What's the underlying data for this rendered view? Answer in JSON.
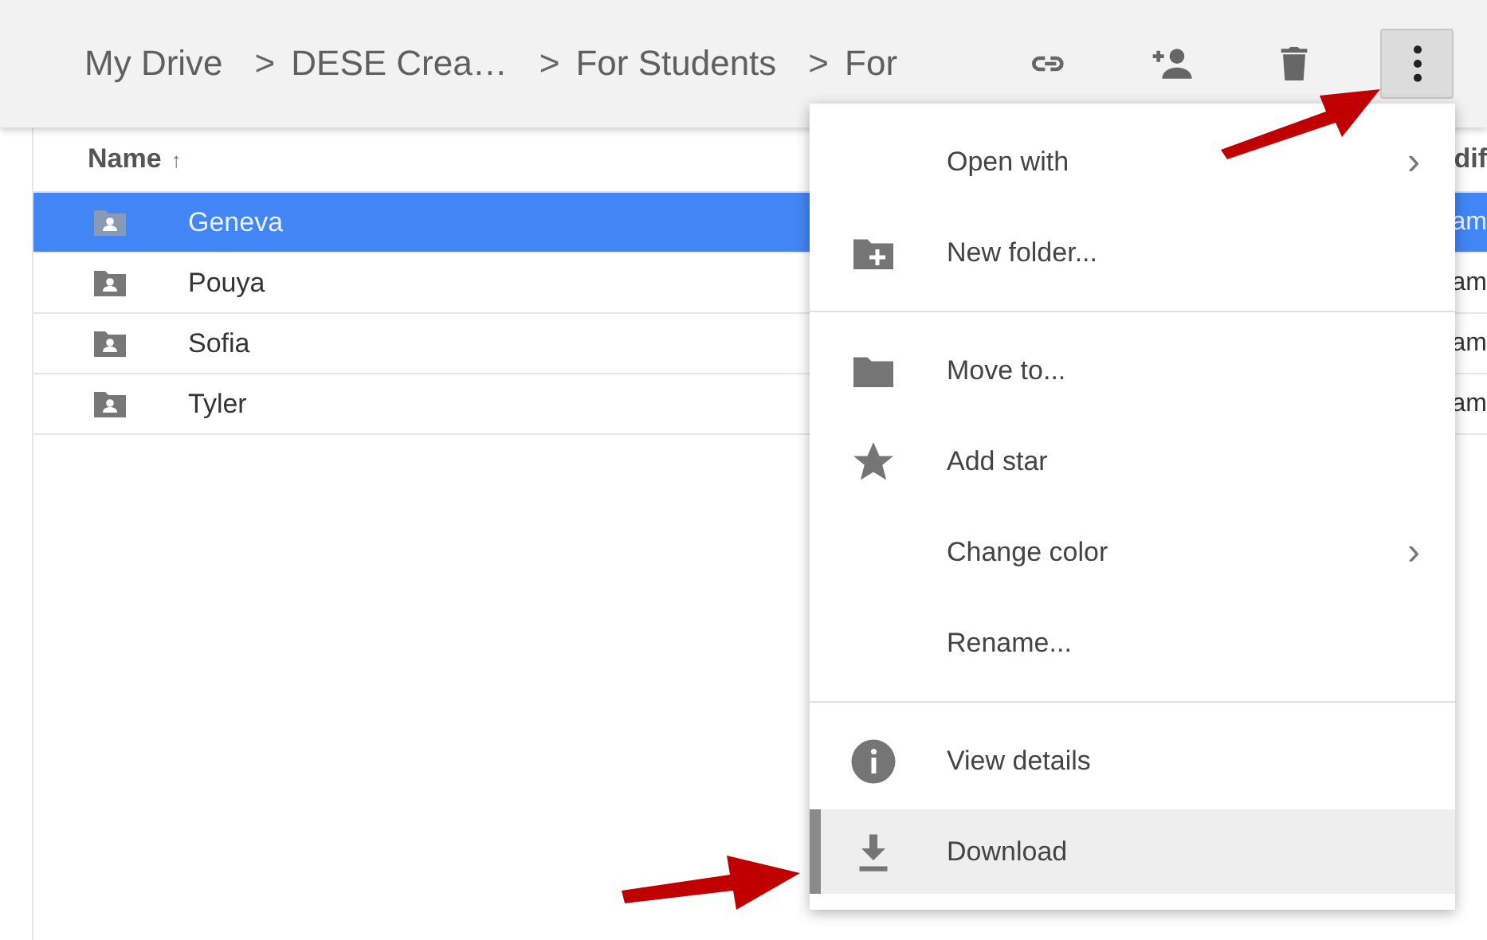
{
  "toolbar": {
    "breadcrumbs": [
      {
        "label": "My Drive"
      },
      {
        "separator": ">",
        "label": "DESE Crea…"
      },
      {
        "separator": ">",
        "label": "For Students"
      },
      {
        "separator": ">",
        "label": "For"
      }
    ],
    "actions": [
      {
        "kind": "link",
        "selected": false
      },
      {
        "kind": "share",
        "selected": false
      },
      {
        "kind": "trash",
        "selected": false
      },
      {
        "kind": "more",
        "selected": true
      }
    ]
  },
  "table": {
    "columns": [
      {
        "label": "Name",
        "sort": "↑"
      },
      {
        "label": "dif"
      }
    ],
    "rows": [
      {
        "name": "Geneva",
        "column_2": "am",
        "selected": true
      },
      {
        "name": "Pouya",
        "column_2": "am",
        "selected": false
      },
      {
        "name": "Sofia",
        "column_2": "am",
        "selected": false
      },
      {
        "name": "Tyler",
        "column_2": "am",
        "selected": false
      }
    ]
  },
  "menu": {
    "sections": [
      [
        {
          "label": "Open with",
          "kind": "plain",
          "chevron": "›",
          "highlighted": false
        },
        {
          "label": "New folder...",
          "kind": "new-folder",
          "highlighted": false
        }
      ],
      [
        {
          "label": "Move to...",
          "kind": "folder",
          "highlighted": false
        },
        {
          "label": "Add star",
          "kind": "star",
          "highlighted": false
        },
        {
          "label": "Change color",
          "kind": "plain",
          "chevron": "›",
          "highlighted": false
        },
        {
          "label": "Rename...",
          "kind": "plain",
          "highlighted": false
        }
      ],
      [
        {
          "label": "View details",
          "kind": "info",
          "highlighted": false
        },
        {
          "label": "Download",
          "kind": "download",
          "highlighted": true
        }
      ]
    ]
  }
}
